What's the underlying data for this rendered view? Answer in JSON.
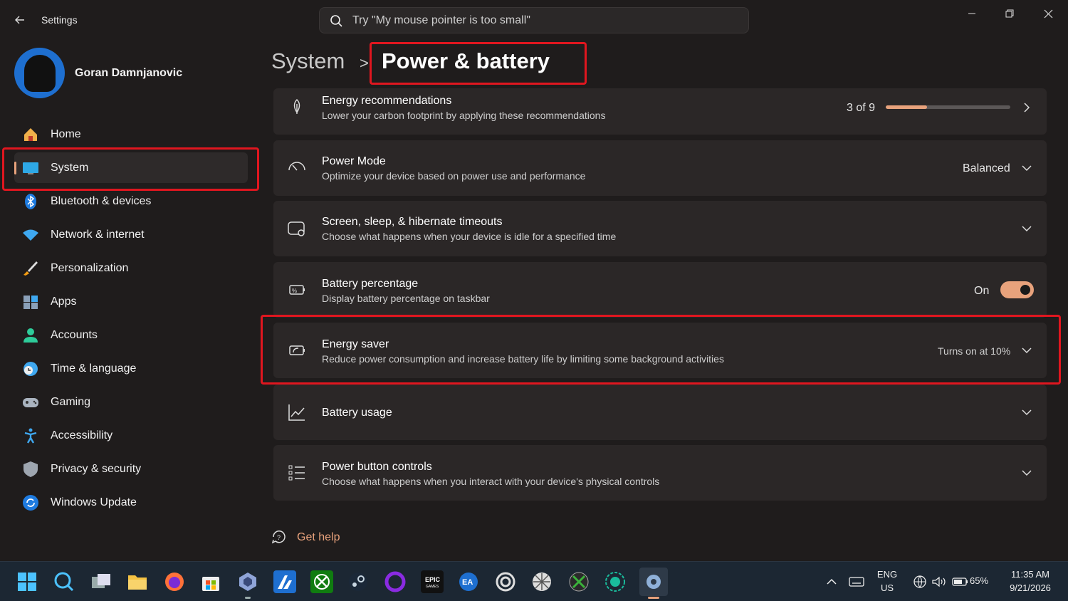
{
  "titlebar": {
    "app_title": "Settings",
    "search_placeholder": "Try \"My mouse pointer is too small\""
  },
  "profile": {
    "name": "Goran Damnjanovic"
  },
  "sidebar": {
    "items": [
      {
        "label": "Home",
        "icon": "home-icon"
      },
      {
        "label": "System",
        "icon": "system-icon",
        "active": true
      },
      {
        "label": "Bluetooth & devices",
        "icon": "bluetooth-icon"
      },
      {
        "label": "Network & internet",
        "icon": "wifi-icon"
      },
      {
        "label": "Personalization",
        "icon": "brush-icon"
      },
      {
        "label": "Apps",
        "icon": "apps-icon"
      },
      {
        "label": "Accounts",
        "icon": "person-icon"
      },
      {
        "label": "Time & language",
        "icon": "clock-globe-icon"
      },
      {
        "label": "Gaming",
        "icon": "gamepad-icon"
      },
      {
        "label": "Accessibility",
        "icon": "accessibility-icon"
      },
      {
        "label": "Privacy & security",
        "icon": "shield-icon"
      },
      {
        "label": "Windows Update",
        "icon": "update-icon"
      }
    ]
  },
  "header": {
    "breadcrumb": "System",
    "separator": ">",
    "title": "Power & battery"
  },
  "cards": {
    "energy_rec": {
      "title": "Energy recommendations",
      "desc": "Lower your carbon footprint by applying these recommendations",
      "progress_text": "3 of 9",
      "progress_fraction": 0.333
    },
    "power_mode": {
      "title": "Power Mode",
      "desc": "Optimize your device based on power use and performance",
      "value": "Balanced"
    },
    "timeouts": {
      "title": "Screen, sleep, & hibernate timeouts",
      "desc": "Choose what happens when your device is idle for a specified time"
    },
    "battery_pct": {
      "title": "Battery percentage",
      "desc": "Display battery percentage on taskbar",
      "state": "On"
    },
    "energy_saver": {
      "title": "Energy saver",
      "desc": "Reduce power consumption and increase battery life by limiting some background activities",
      "status": "Turns on at 10%"
    },
    "battery_usage": {
      "title": "Battery usage"
    },
    "power_button": {
      "title": "Power button controls",
      "desc": "Choose what happens when you interact with your device's physical controls"
    }
  },
  "get_help": "Get help",
  "taskbar": {
    "apps": [
      "start-icon",
      "search-icon",
      "task-view-icon",
      "file-explorer-icon",
      "firefox-icon",
      "store-icon",
      "toolbox-icon",
      "affinity-icon",
      "xbox-icon",
      "steam-icon",
      "circle-app-icon",
      "epic-games-icon",
      "ea-icon",
      "ubisoft-icon",
      "gog-icon",
      "xbox-alt-icon",
      "gamebar-icon",
      "settings-icon"
    ],
    "lang_line1": "ENG",
    "lang_line2": "US",
    "battery": "65%",
    "time": "11:35 AM",
    "date": "9/21/2026"
  },
  "colors": {
    "accent": "#e8a27c",
    "highlight": "#e0161f",
    "background": "#1f1c1c",
    "card": "#2b2727"
  }
}
